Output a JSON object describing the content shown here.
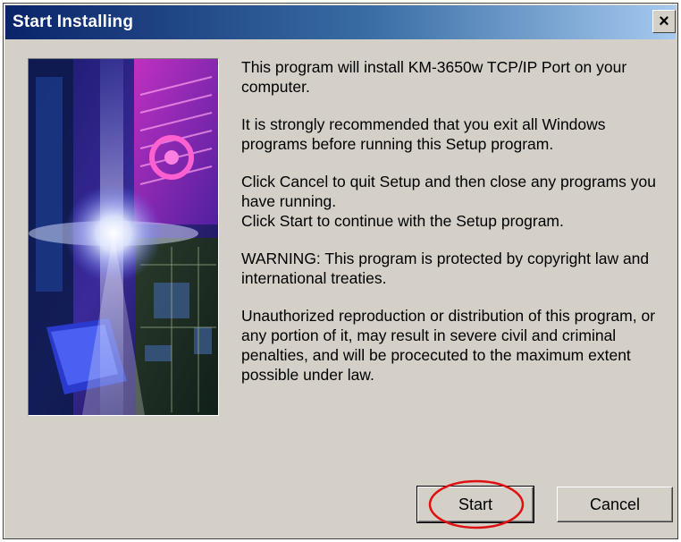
{
  "window": {
    "title": "Start Installing",
    "close_glyph": "×"
  },
  "message": {
    "paragraphs": [
      "This program will install KM-3650w TCP/IP Port on your computer.",
      "It is strongly recommended that you exit all Windows programs before running this Setup program.",
      "Click Cancel to quit Setup and then close any programs you have running.",
      "Click Start to continue with the Setup program.",
      "WARNING: This program is protected by copyright law and international treaties.",
      "Unauthorized reproduction or distribution of this program, or any portion of it, may result in severe civil and criminal penalties, and will be procecuted to the maximum extent possible under law."
    ]
  },
  "buttons": {
    "start_label": "Start",
    "cancel_label": "Cancel"
  },
  "colors": {
    "dialog_face": "#d4d0c8",
    "titlebar_start": "#0a246a",
    "titlebar_end": "#a6caf0",
    "highlight_ring": "#e01010"
  },
  "icons": [
    "close-icon"
  ]
}
